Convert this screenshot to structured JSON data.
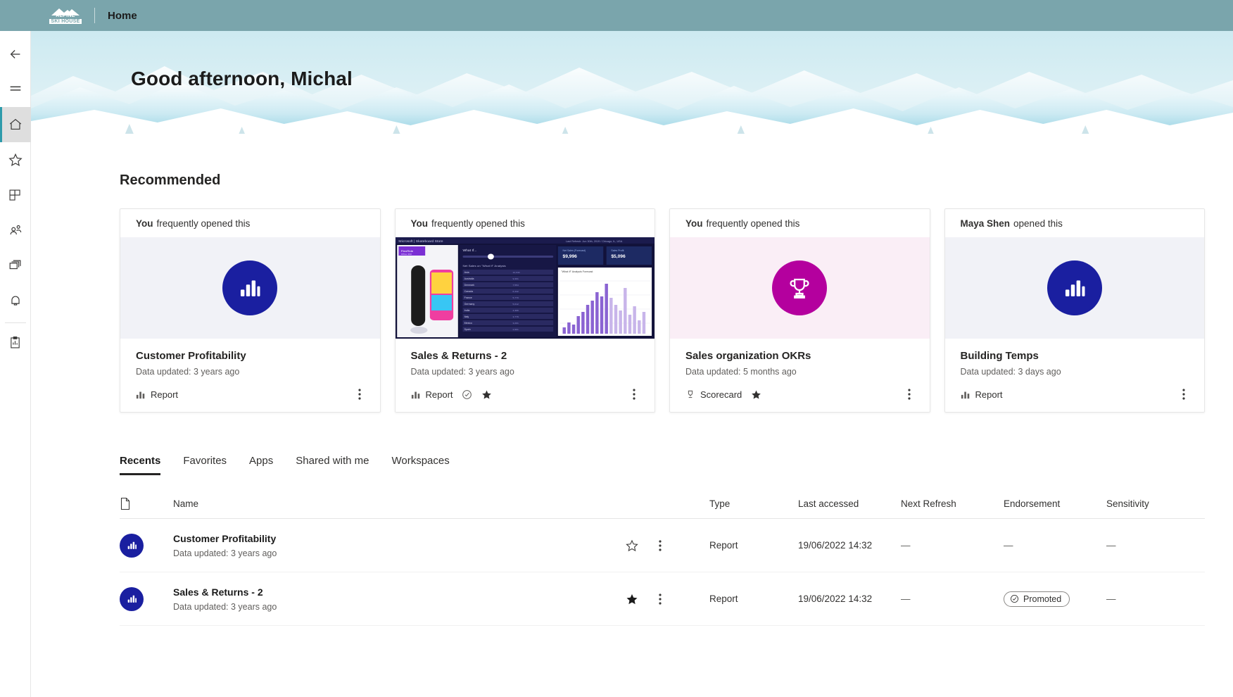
{
  "topbar": {
    "brand_line1": "ALPINE",
    "brand_line2": "SKI HOUSE",
    "title": "Home"
  },
  "leftnav": {
    "items": [
      {
        "name": "back",
        "label": "Back"
      },
      {
        "name": "menu",
        "label": "Show navigation"
      },
      {
        "name": "home",
        "label": "Home"
      },
      {
        "name": "favorites",
        "label": "Favorites"
      },
      {
        "name": "apps",
        "label": "Apps"
      },
      {
        "name": "shared-with-me",
        "label": "Shared with me"
      },
      {
        "name": "workspaces",
        "label": "Workspaces"
      },
      {
        "name": "notifications",
        "label": "Notifications"
      },
      {
        "name": "metrics",
        "label": "Metrics"
      }
    ],
    "selected": "home"
  },
  "banner": {
    "greeting": "Good afternoon, Michal"
  },
  "recommended": {
    "title": "Recommended",
    "cards": [
      {
        "attribution_actor": "You",
        "attribution_text": "frequently opened this",
        "name": "Customer Profitability",
        "updated": "Data updated: 3 years ago",
        "type_label": "Report",
        "type_icon": "report-icon",
        "thumb": "blue-circle-bar-chart",
        "certified": false,
        "favorite": false
      },
      {
        "attribution_actor": "You",
        "attribution_text": "frequently opened this",
        "name": "Sales & Returns  - 2",
        "updated": "Data updated: 3 years ago",
        "type_label": "Report",
        "type_icon": "report-icon",
        "thumb": "report-screenshot",
        "certified": true,
        "favorite": true
      },
      {
        "attribution_actor": "You",
        "attribution_text": "frequently opened this",
        "name": "Sales organization OKRs",
        "updated": "Data updated: 5 months ago",
        "type_label": "Scorecard",
        "type_icon": "trophy-icon",
        "thumb": "magenta-circle-trophy",
        "certified": false,
        "favorite": true
      },
      {
        "attribution_actor": "Maya Shen",
        "attribution_text": "opened this",
        "name": "Building Temps",
        "updated": "Data updated: 3 days ago",
        "type_label": "Report",
        "type_icon": "report-icon",
        "thumb": "blue-circle-bar-chart",
        "certified": false,
        "favorite": false
      }
    ]
  },
  "tabs": [
    {
      "label": "Recents",
      "active": true
    },
    {
      "label": "Favorites",
      "active": false
    },
    {
      "label": "Apps",
      "active": false
    },
    {
      "label": "Shared with me",
      "active": false
    },
    {
      "label": "Workspaces",
      "active": false
    }
  ],
  "table": {
    "columns": {
      "name": "Name",
      "type": "Type",
      "last_accessed": "Last accessed",
      "next_refresh": "Next Refresh",
      "endorsement": "Endorsement",
      "sensitivity": "Sensitivity"
    },
    "rows": [
      {
        "name": "Customer Profitability",
        "updated": "Data updated: 3 years ago",
        "favorite": false,
        "type": "Report",
        "last_accessed": "19/06/2022 14:32",
        "next_refresh": "—",
        "endorsement": "—",
        "endorsement_badge": null,
        "sensitivity": "—"
      },
      {
        "name": "Sales & Returns  - 2",
        "updated": "Data updated: 3 years ago",
        "favorite": true,
        "type": "Report",
        "last_accessed": "19/06/2022 14:32",
        "next_refresh": "—",
        "endorsement": "",
        "endorsement_badge": "Promoted",
        "sensitivity": "—"
      }
    ]
  },
  "colors": {
    "topbar": "#7AA5AC",
    "accent_blue": "#1a1fa0",
    "accent_magenta": "#b4009e",
    "selected_nav": "#2e9bab"
  }
}
